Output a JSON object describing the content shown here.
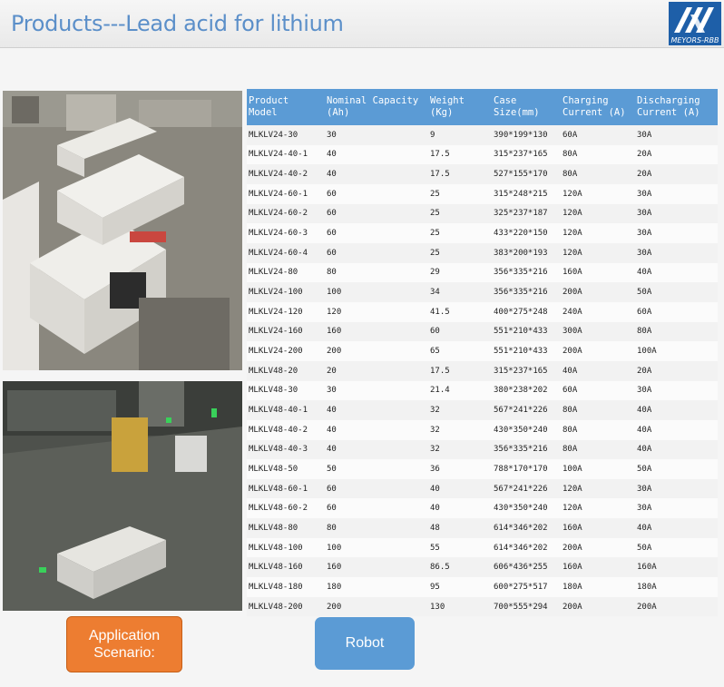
{
  "header": {
    "title": "Products---Lead acid for lithium",
    "logo_text": "MEYORS-RBB"
  },
  "table": {
    "columns": [
      "Product Model",
      "Nominal Capacity (Ah)",
      "Weight (Kg)",
      "Case Size(mm)",
      "Charging Current (A)",
      "Discharging Current (A)"
    ],
    "rows": [
      [
        "MLKLV24-30",
        "30",
        "9",
        "390*199*130",
        "60A",
        "30A"
      ],
      [
        "MLKLV24-40-1",
        "40",
        "17.5",
        "315*237*165",
        "80A",
        "20A"
      ],
      [
        "MLKLV24-40-2",
        "40",
        "17.5",
        "527*155*170",
        "80A",
        "20A"
      ],
      [
        "MLKLV24-60-1",
        "60",
        "25",
        "315*248*215",
        "120A",
        "30A"
      ],
      [
        "MLKLV24-60-2",
        "60",
        "25",
        "325*237*187",
        "120A",
        "30A"
      ],
      [
        "MLKLV24-60-3",
        "60",
        "25",
        "433*220*150",
        "120A",
        "30A"
      ],
      [
        "MLKLV24-60-4",
        "60",
        "25",
        "383*200*193",
        "120A",
        "30A"
      ],
      [
        "MLKLV24-80",
        "80",
        "29",
        "356*335*216",
        "160A",
        "40A"
      ],
      [
        "MLKLV24-100",
        "100",
        "34",
        "356*335*216",
        "200A",
        "50A"
      ],
      [
        "MLKLV24-120",
        "120",
        "41.5",
        "400*275*248",
        "240A",
        "60A"
      ],
      [
        "MLKLV24-160",
        "160",
        "60",
        "551*210*433",
        "300A",
        "80A"
      ],
      [
        "MLKLV24-200",
        "200",
        "65",
        "551*210*433",
        "200A",
        "100A"
      ],
      [
        "MLKLV48-20",
        "20",
        "17.5",
        "315*237*165",
        "40A",
        "20A"
      ],
      [
        "MLKLV48-30",
        "30",
        "21.4",
        "380*238*202",
        "60A",
        "30A"
      ],
      [
        "MLKLV48-40-1",
        "40",
        "32",
        "567*241*226",
        "80A",
        "40A"
      ],
      [
        "MLKLV48-40-2",
        "40",
        "32",
        "430*350*240",
        "80A",
        "40A"
      ],
      [
        "MLKLV48-40-3",
        "40",
        "32",
        "356*335*216",
        "80A",
        "40A"
      ],
      [
        "MLKLV48-50",
        "50",
        "36",
        "788*170*170",
        "100A",
        "50A"
      ],
      [
        "MLKLV48-60-1",
        "60",
        "40",
        "567*241*226",
        "120A",
        "30A"
      ],
      [
        "MLKLV48-60-2",
        "60",
        "40",
        "430*350*240",
        "120A",
        "30A"
      ],
      [
        "MLKLV48-80",
        "80",
        "48",
        "614*346*202",
        "160A",
        "40A"
      ],
      [
        "MLKLV48-100",
        "100",
        "55",
        "614*346*202",
        "200A",
        "50A"
      ],
      [
        "MLKLV48-160",
        "160",
        "86.5",
        "606*436*255",
        "160A",
        "160A"
      ],
      [
        "MLKLV48-180",
        "180",
        "95",
        "600*275*517",
        "180A",
        "180A"
      ],
      [
        "MLKLV48-200",
        "200",
        "130",
        "700*555*294",
        "200A",
        "200A"
      ]
    ]
  },
  "buttons": {
    "application_label": "Application Scenario:",
    "robot_label": "Robot"
  },
  "colors": {
    "title": "#5b8fc9",
    "table_header": "#5b9bd5",
    "application_button": "#ed7d31",
    "robot_button": "#5b9bd5",
    "logo": "#1e5fa8"
  }
}
